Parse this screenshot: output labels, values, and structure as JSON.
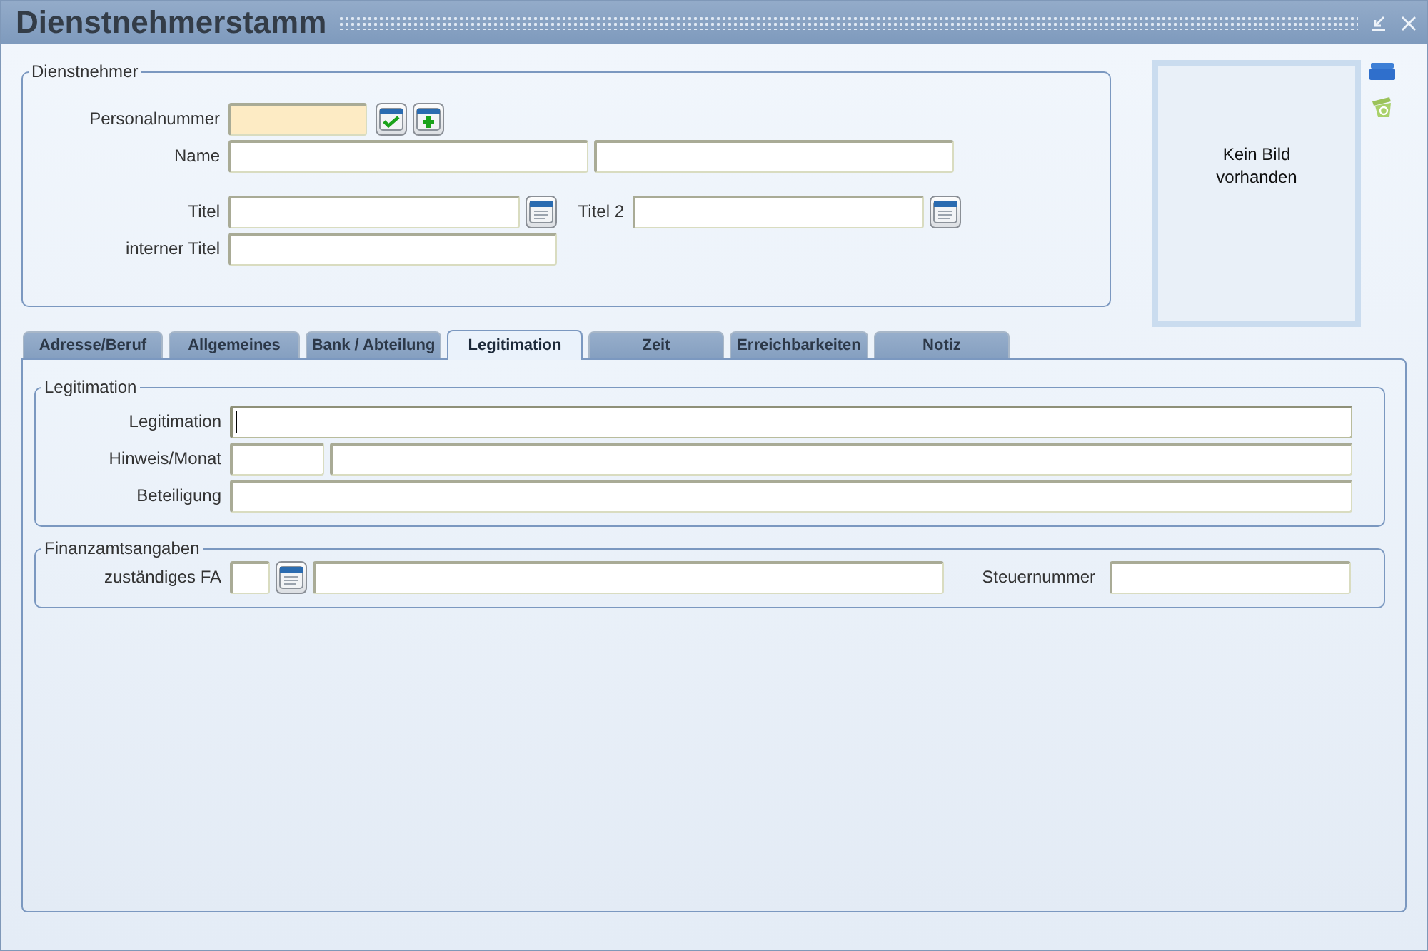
{
  "window": {
    "title": "Dienstnehmerstamm"
  },
  "dienstnehmer": {
    "legend": "Dienstnehmer",
    "fields": [
      {
        "label": "Personalnummer",
        "required": true
      },
      {
        "label": "Name",
        "required": false
      },
      {
        "label": "Titel",
        "required": false
      },
      {
        "label": "Titel 2",
        "required": false
      },
      {
        "label": "interner Titel",
        "required": false
      }
    ]
  },
  "photo": {
    "text": "Kein Bild vorhanden"
  },
  "tabs": [
    {
      "label": "Adresse/Beruf",
      "selected": false
    },
    {
      "label": "Allgemeines",
      "selected": false
    },
    {
      "label": "Bank / Abteilung",
      "selected": false
    },
    {
      "label": "Legitimation",
      "selected": true
    },
    {
      "label": "Zeit",
      "selected": false
    },
    {
      "label": "Erreichbarkeiten",
      "selected": false
    },
    {
      "label": "Notiz",
      "selected": false
    }
  ],
  "legitimation": {
    "legend": "Legitimation",
    "fields": [
      {
        "label": "Legitimation",
        "focused": true
      },
      {
        "label": "Hinweis/Monat",
        "focused": false
      },
      {
        "label": "Beteiligung",
        "focused": false
      }
    ]
  },
  "finanzamt": {
    "legend": "Finanzamtsangaben",
    "fields": [
      {
        "label": "zuständiges FA"
      },
      {
        "label": "Steuernummer"
      }
    ]
  }
}
